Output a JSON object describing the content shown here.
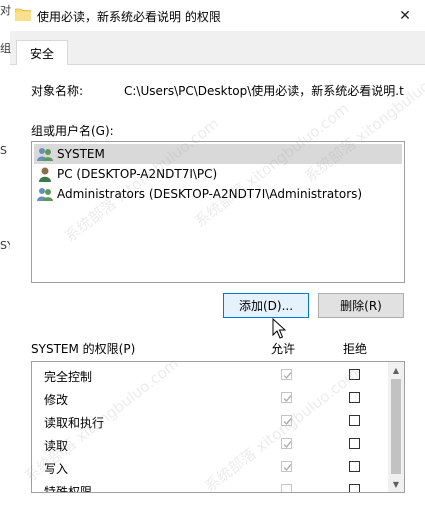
{
  "window": {
    "title": "使用必读，新系统必看说明 的权限",
    "close_glyph": "✕",
    "edge_text": "对"
  },
  "background_left": [
    "组",
    "S",
    "SY"
  ],
  "tabs": [
    {
      "label": "安全",
      "selected": true
    }
  ],
  "object": {
    "label": "对象名称:",
    "value": "C:\\Users\\PC\\Desktop\\使用必读，新系统必看说明.t"
  },
  "groups": {
    "label": "组或用户名(G):",
    "users": [
      {
        "name": "SYSTEM",
        "icon": "group-users-icon",
        "selected": true
      },
      {
        "name": "PC (DESKTOP-A2NDT7I\\PC)",
        "icon": "user-icon",
        "selected": false
      },
      {
        "name": "Administrators (DESKTOP-A2NDT7I\\Administrators)",
        "icon": "group-users-icon",
        "selected": false
      }
    ]
  },
  "buttons": {
    "add": "添加(D)...",
    "remove": "删除(R)"
  },
  "permissions": {
    "title": "SYSTEM 的权限(P)",
    "allow_header": "允许",
    "deny_header": "拒绝",
    "rows": [
      {
        "name": "完全控制",
        "allow": true,
        "deny": false
      },
      {
        "name": "修改",
        "allow": true,
        "deny": false
      },
      {
        "name": "读取和执行",
        "allow": true,
        "deny": false
      },
      {
        "name": "读取",
        "allow": true,
        "deny": false
      },
      {
        "name": "写入",
        "allow": true,
        "deny": false
      },
      {
        "name": "特殊权限",
        "allow": false,
        "deny": false
      }
    ]
  },
  "watermark": "系统部落 xitongbuluo.com",
  "colors": {
    "selected_row": "#d9d9d9",
    "focus_border": "#0078d7",
    "disabled_check": "#b0b0b0"
  }
}
